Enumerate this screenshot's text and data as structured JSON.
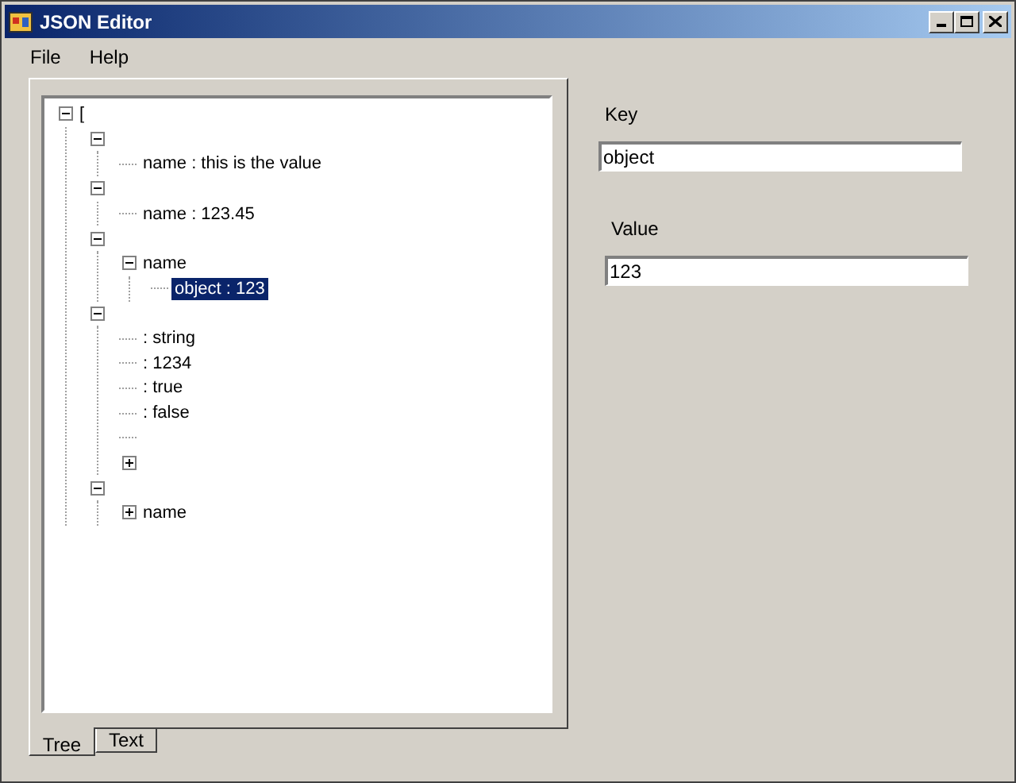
{
  "window": {
    "title": "JSON Editor"
  },
  "menu": [
    "File",
    "Help"
  ],
  "tree": {
    "label": "[",
    "expanded": true,
    "children": [
      {
        "expanded": true,
        "children": [
          {
            "label": "name : this is the value",
            "selected": false
          }
        ]
      },
      {
        "expanded": true,
        "children": [
          {
            "label": "name : 123.45",
            "selected": false
          }
        ]
      },
      {
        "expanded": true,
        "children": [
          {
            "label": "name",
            "expanded": true,
            "children": [
              {
                "label": "object : 123",
                "selected": true
              }
            ]
          }
        ]
      },
      {
        "expanded": true,
        "children": [
          {
            "label": ": string",
            "selected": false
          },
          {
            "label": ": 1234",
            "selected": false
          },
          {
            "label": ": true",
            "selected": false
          },
          {
            "label": ": false",
            "selected": false
          },
          {
            "selected": false
          },
          {
            "expanded": false
          }
        ]
      },
      {
        "expanded": true,
        "children": [
          {
            "label": "name",
            "expanded": false
          }
        ]
      }
    ]
  },
  "tabs": [
    {
      "label": "Tree",
      "selected": true
    },
    {
      "label": "Text",
      "selected": false
    }
  ],
  "key": {
    "label": "Key",
    "value": "object"
  },
  "value": {
    "label": "Value",
    "value": "123"
  }
}
